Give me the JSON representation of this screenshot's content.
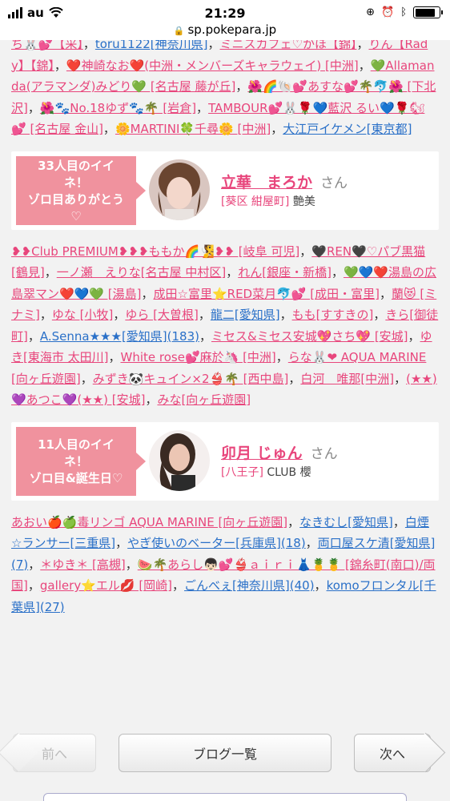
{
  "status_bar": {
    "carrier": "au",
    "time": "21:29",
    "url": "sp.pokepara.jp",
    "battery_level": 0.85
  },
  "likes_top": [
    {
      "text": "ち🐰💕【采】",
      "blue": false
    },
    {
      "text": "toru1122[神奈川県]",
      "blue": true
    },
    {
      "text": "ミニスカフェ♡かほ【錦】",
      "blue": false
    },
    {
      "text": "りん【Rady】【錦】",
      "blue": false
    },
    {
      "text": "❤️神崎なお❤️(中洲・メンバーズキャラウェイ) [中洲]",
      "blue": false
    },
    {
      "text": "💚Allamanda(アラマンダ)みどり💚 [名古屋 藤が丘]",
      "blue": false
    },
    {
      "text": "🌺🌈🐚💕あすな💕🌴🐬🌺 [下北沢]",
      "blue": false
    },
    {
      "text": "🌺🐾No.18ゆず🐾🌴 [岩倉]",
      "blue": false
    },
    {
      "text": "TAMBOUR💕🐰🌹💙藍沢 るい💙🌹🐿💕 [名古屋 金山]",
      "blue": false
    },
    {
      "text": "🌼MARTINI🍀千尋🌼 [中洲]",
      "blue": false
    },
    {
      "text": "大江戸イケメン[東京都]",
      "blue": true
    }
  ],
  "milestone_1": {
    "badge": [
      "33人目のイイ",
      "ネ！",
      "ゾロ目ありがとう",
      "♡"
    ],
    "name": "立華　まろか",
    "san": "さん",
    "area": "[葵区 紺屋町]",
    "shop": "艶美"
  },
  "likes_middle": [
    {
      "text": "❥❥Club PREMIUM❥❥❥ももか🌈🧏❥❥ [岐阜 可児]",
      "blue": false
    },
    {
      "text": "🖤REN🖤♡パブ黒猫 [鶴見]",
      "blue": false
    },
    {
      "text": "一ノ瀬　えりな[名古屋 中村区]",
      "blue": false
    },
    {
      "text": "れん[銀座・新橋]",
      "blue": false
    },
    {
      "text": "💚💙❤️湯島の広島翠マン❤️💙💚 [湯島]",
      "blue": false
    },
    {
      "text": "成田☆富里⭐RED菜月🐬💕 [成田・富里]",
      "blue": false
    },
    {
      "text": "蘭😻 [ミナミ]",
      "blue": false
    },
    {
      "text": "ゆな [小牧]",
      "blue": false
    },
    {
      "text": "ゆら [大曽根]",
      "blue": false
    },
    {
      "text": "龍二[愛知県]",
      "blue": true
    },
    {
      "text": "もも[すすきの]",
      "blue": false
    },
    {
      "text": "きら[御徒町]",
      "blue": false
    },
    {
      "text": "A.Senna★★★[愛知県](183)",
      "blue": true
    },
    {
      "text": "ミセス&ミセス安城💖さち💖 [安城]",
      "blue": false
    },
    {
      "text": "ゆき[東海市 太田川]",
      "blue": false
    },
    {
      "text": "White rose💕麻於🦄 [中洲]",
      "blue": false
    },
    {
      "text": "らな🐰❤ AQUA MARINE [向ヶ丘遊園]",
      "blue": false
    },
    {
      "text": "みずき🐼キュイン×2👙🌴 [西中島]",
      "blue": false
    },
    {
      "text": "白河　唯那[中洲]",
      "blue": false
    },
    {
      "text": "(★★)💜あつこ💜(★★) [安城]",
      "blue": false
    },
    {
      "text": "みな[向ヶ丘遊園]",
      "blue": false
    }
  ],
  "milestone_2": {
    "badge": [
      "11人目のイイ",
      "ネ！",
      "ゾロ目&誕生日♡"
    ],
    "name": "卯月 じゅん",
    "san": "さん",
    "area": "[八王子]",
    "shop": "CLUB 櫻"
  },
  "likes_bottom": [
    {
      "text": "あおい🍎🍏毒リンゴ AQUA MARINE [向ヶ丘遊園]",
      "blue": false
    },
    {
      "text": "なきむし[愛知県]",
      "blue": true
    },
    {
      "text": "白煙☆ランサー[三重県]",
      "blue": true
    },
    {
      "text": "やぎ使いのベーター[兵庫県](18)",
      "blue": true
    },
    {
      "text": "両口屋スケ清[愛知県](7)",
      "blue": true
    },
    {
      "text": "＊ゆき＊ [高槻]",
      "blue": false
    },
    {
      "text": "🍉🌴あらし👦🏻💕👙ａｉｒｉ👗🍍🍍 [錦糸町(南口)/両国]",
      "blue": false
    },
    {
      "text": "gallery⭐エル💋 [岡崎]",
      "blue": false
    },
    {
      "text": "ごんべぇ[神奈川県](40)",
      "blue": true
    },
    {
      "text": "komoフロンタル[千葉県](27)",
      "blue": true
    }
  ],
  "nav": {
    "prev": "前へ",
    "list": "ブログ一覧",
    "next": "次へ"
  }
}
